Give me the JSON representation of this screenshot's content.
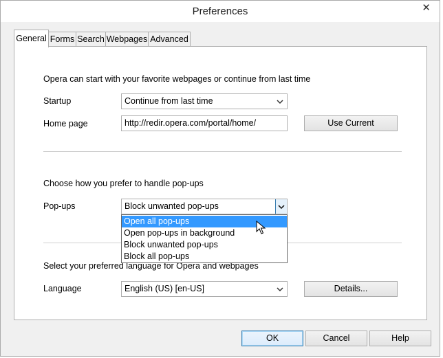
{
  "window": {
    "title": "Preferences"
  },
  "tabs": [
    {
      "label": "General",
      "active": true
    },
    {
      "label": "Forms",
      "active": false
    },
    {
      "label": "Search",
      "active": false
    },
    {
      "label": "Webpages",
      "active": false
    },
    {
      "label": "Advanced",
      "active": false
    }
  ],
  "startup_section": {
    "intro": "Opera can start with your favorite webpages or continue from last time",
    "startup_label": "Startup",
    "startup_value": "Continue from last time",
    "homepage_label": "Home page",
    "homepage_value": "http://redir.opera.com/portal/home/",
    "use_current_label": "Use Current"
  },
  "popups_section": {
    "intro": "Choose how you prefer to handle pop-ups",
    "label": "Pop-ups",
    "value": "Block unwanted pop-ups",
    "options": [
      {
        "label": "Open all pop-ups",
        "highlighted": true
      },
      {
        "label": "Open pop-ups in background",
        "highlighted": false
      },
      {
        "label": "Block unwanted pop-ups",
        "highlighted": false
      },
      {
        "label": "Block all pop-ups",
        "highlighted": false
      }
    ]
  },
  "language_section": {
    "intro": "Select your preferred language for Opera and webpages",
    "label": "Language",
    "value": "English (US) [en-US]",
    "details_label": "Details..."
  },
  "footer": {
    "ok_label": "OK",
    "cancel_label": "Cancel",
    "help_label": "Help"
  },
  "icons": {
    "close": "close-icon",
    "dropdown": "chevron-down-icon",
    "cursor": "mouse-pointer-icon"
  },
  "colors": {
    "highlight": "#3399ff",
    "default_button_border": "#3c7fb1"
  }
}
